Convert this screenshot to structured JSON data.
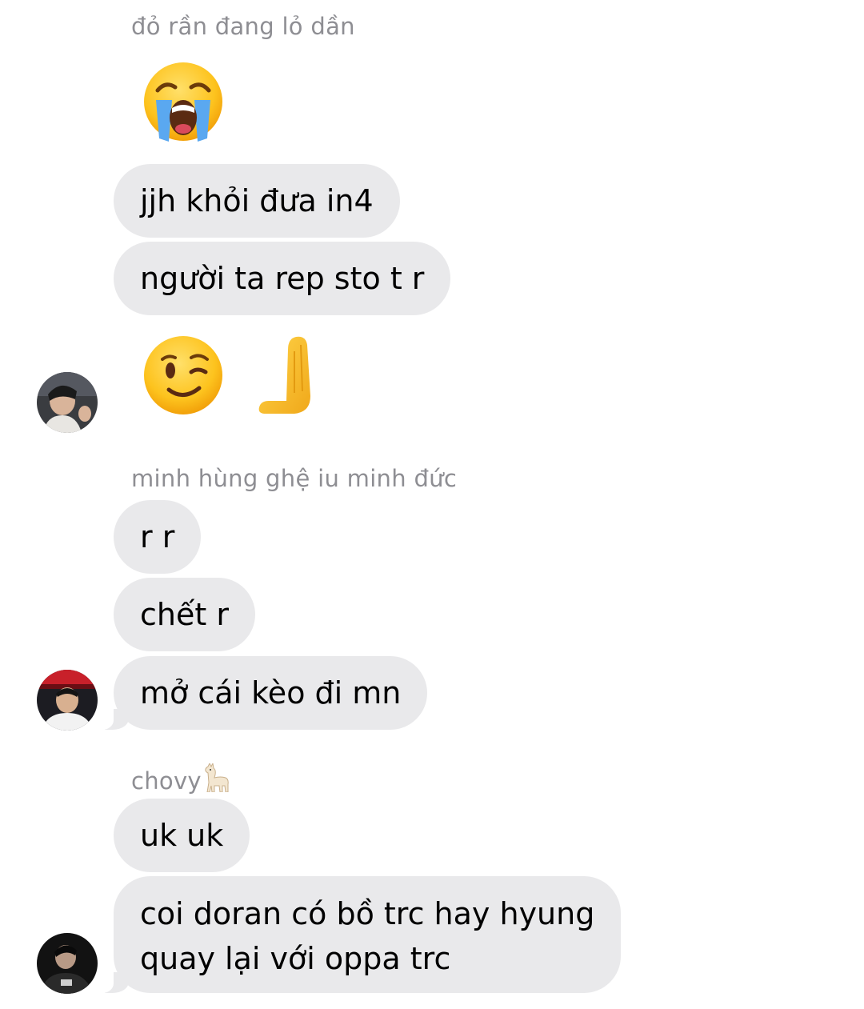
{
  "conversation": {
    "groups": [
      {
        "sender": "đỏ rần đang lỏ dần",
        "messages": [
          "jjh khỏi đưa in4",
          "người ta rep sto t r"
        ],
        "emoji_top": "loudly-crying-face",
        "emoji_bottom": [
          "winking-face",
          "raised-back-of-hand-pointing-left"
        ]
      },
      {
        "sender": "minh hùng ghệ iu minh đức",
        "messages": [
          "r r",
          "chết r",
          "mở cái kèo đi mn"
        ]
      },
      {
        "sender": "chovy",
        "sender_emoji": "llama",
        "messages": [
          "uk uk",
          "coi doran có bồ trc hay hyung",
          "quay lại với oppa trc"
        ]
      }
    ]
  },
  "colors": {
    "bubble": "#e9e9eb",
    "sender_text": "#8e8e93",
    "message_text": "#000000",
    "background": "#ffffff"
  }
}
